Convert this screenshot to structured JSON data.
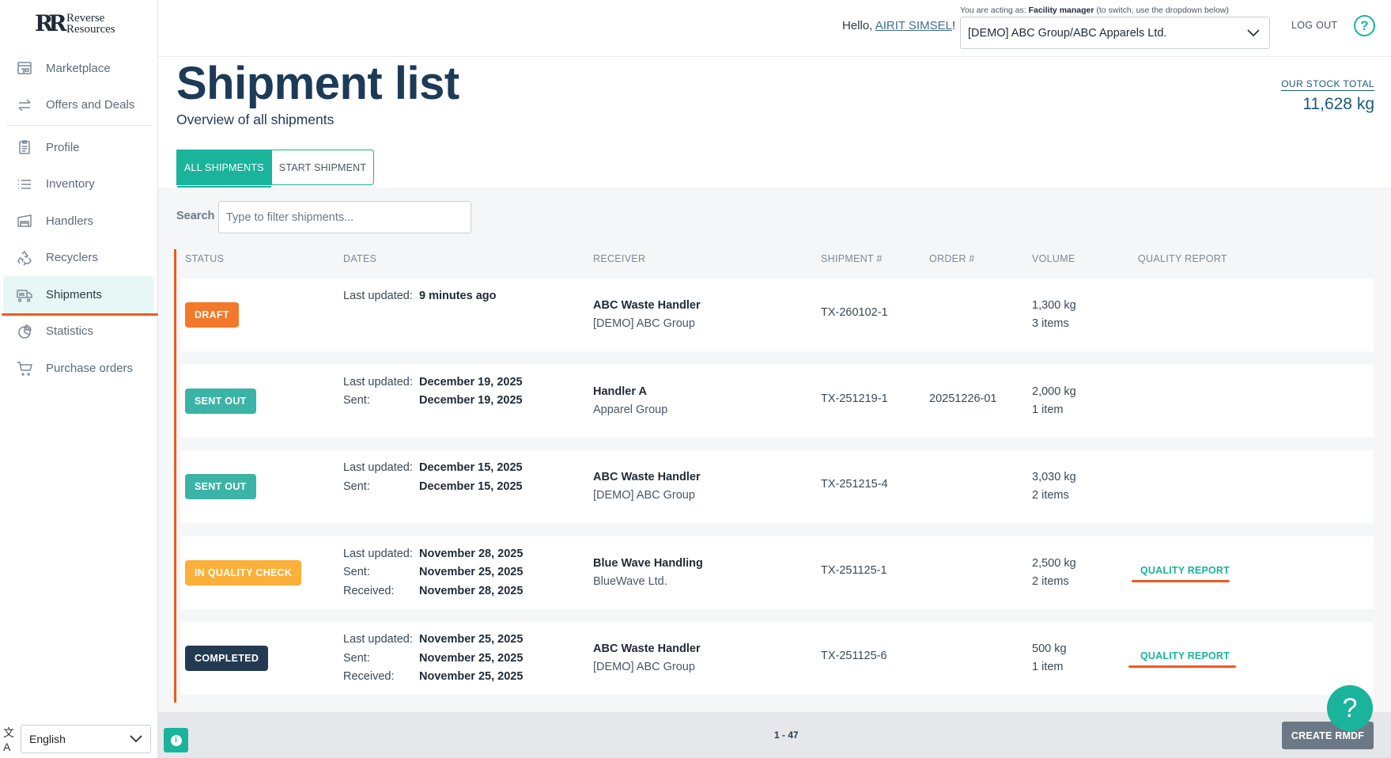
{
  "brand": {
    "logo_mark": "RR",
    "name_line1": "Reverse",
    "name_line2": "Resources"
  },
  "sidebar": {
    "items": [
      {
        "label": "Marketplace",
        "icon": "store-icon"
      },
      {
        "label": "Offers and Deals",
        "icon": "swap-arrows-icon"
      },
      {
        "label": "Profile",
        "icon": "clipboard-icon"
      },
      {
        "label": "Inventory",
        "icon": "list-icon"
      },
      {
        "label": "Handlers",
        "icon": "warehouse-icon"
      },
      {
        "label": "Recyclers",
        "icon": "recycle-icon"
      },
      {
        "label": "Shipments",
        "icon": "truck-icon"
      },
      {
        "label": "Statistics",
        "icon": "pie-chart-icon"
      },
      {
        "label": "Purchase orders",
        "icon": "cart-icon"
      }
    ],
    "active": "Shipments",
    "language": {
      "icon": "translate-icon",
      "value": "English"
    }
  },
  "topbar": {
    "hello_prefix": "Hello, ",
    "user_name": "AIRIT SIMSEL",
    "hello_suffix": "!",
    "acting_prefix": "You are acting as: ",
    "acting_role": "Facility manager",
    "acting_suffix": " (to switch, use the dropdown below)",
    "org_value": "[DEMO] ABC Group/ABC Apparels Ltd.",
    "logout": "LOG OUT",
    "help": "?"
  },
  "header": {
    "title": "Shipment list",
    "subtitle": "Overview of all shipments",
    "stock_label": "OUR STOCK TOTAL",
    "stock_value": "11,628 kg"
  },
  "tabs": [
    {
      "label": "ALL SHIPMENTS"
    },
    {
      "label": "START SHIPMENT"
    }
  ],
  "search": {
    "label": "Search",
    "placeholder": "Type to filter shipments..."
  },
  "table": {
    "columns": [
      "STATUS",
      "DATES",
      "RECEIVER",
      "SHIPMENT #",
      "ORDER #",
      "VOLUME",
      "QUALITY REPORT"
    ],
    "rows": [
      {
        "status": "DRAFT",
        "status_color": "#f4782a",
        "dates": [
          {
            "label": "Last updated:",
            "value": "9 minutes ago"
          }
        ],
        "receiver_name": "ABC Waste Handler",
        "receiver_org": "[DEMO] ABC Group",
        "shipment": "TX-260102-1",
        "order": "",
        "volume_kg": "1,300 kg",
        "volume_items": "3 items",
        "quality_report": ""
      },
      {
        "status": "SENT OUT",
        "status_color": "#3bb3a6",
        "dates": [
          {
            "label": "Last updated:",
            "value": "December 19, 2025"
          },
          {
            "label": "Sent:",
            "value": "December 19, 2025"
          }
        ],
        "receiver_name": "Handler A",
        "receiver_org": "Apparel Group",
        "shipment": "TX-251219-1",
        "order": "20251226-01",
        "volume_kg": "2,000 kg",
        "volume_items": "1 item",
        "quality_report": ""
      },
      {
        "status": "SENT OUT",
        "status_color": "#3bb3a6",
        "dates": [
          {
            "label": "Last updated:",
            "value": "December 15, 2025"
          },
          {
            "label": "Sent:",
            "value": "December 15, 2025"
          }
        ],
        "receiver_name": "ABC Waste Handler",
        "receiver_org": "[DEMO] ABC Group",
        "shipment": "TX-251215-4",
        "order": "",
        "volume_kg": "3,030 kg",
        "volume_items": "2 items",
        "quality_report": ""
      },
      {
        "status": "IN QUALITY CHECK",
        "status_color": "#fbb03b",
        "dates": [
          {
            "label": "Last updated:",
            "value": "November 28, 2025"
          },
          {
            "label": "Sent:",
            "value": "November 25, 2025"
          },
          {
            "label": "Received:",
            "value": "November 28, 2025"
          }
        ],
        "receiver_name": "Blue Wave Handling",
        "receiver_org": "BlueWave Ltd.",
        "shipment": "TX-251125-1",
        "order": "",
        "volume_kg": "2,500 kg",
        "volume_items": "2 items",
        "quality_report": "QUALITY REPORT"
      },
      {
        "status": "COMPLETED",
        "status_color": "#233a52",
        "dates": [
          {
            "label": "Last updated:",
            "value": "November 25, 2025"
          },
          {
            "label": "Sent:",
            "value": "November 25, 2025"
          },
          {
            "label": "Received:",
            "value": "November 25, 2025"
          }
        ],
        "receiver_name": "ABC Waste Handler",
        "receiver_org": "[DEMO] ABC Group",
        "shipment": "TX-251125-6",
        "order": "",
        "volume_kg": "500 kg",
        "volume_items": "1 item",
        "quality_report": "QUALITY REPORT"
      }
    ]
  },
  "footer": {
    "info_icon": "info-icon",
    "info_glyph": "i",
    "pager": "1 - 47",
    "create_button": "CREATE RMDF",
    "help_fab": "?"
  },
  "colors": {
    "accent": "#1ab39c",
    "highlight": "#f05a1e",
    "title": "#1d3a57"
  }
}
